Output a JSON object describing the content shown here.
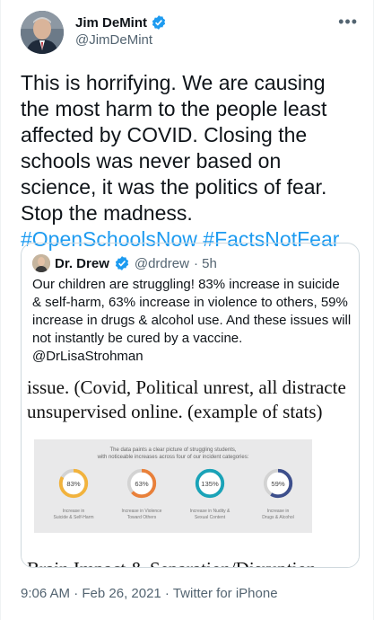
{
  "author": {
    "display_name": "Jim DeMint",
    "handle": "@JimDeMint",
    "avatar_icon": "avatar-photo",
    "verified_icon": "verified-badge-icon"
  },
  "tweet": {
    "text": "This is horrifying. We are causing the most harm to the people least affected by COVID. Closing the schools was never based on science, it was the politics of fear. Stop the madness.",
    "hashtags": "#OpenSchoolsNow #FactsNotFear"
  },
  "quote": {
    "display_name": "Dr. Drew",
    "handle": "@drdrew",
    "time": "· 5h",
    "text": "Our children are struggling! 83% increase in suicide & self-harm, 63% increase in violence to others, 59% increase in drugs & alcohol use. And these issues will not instantly be cured by a vaccine. @DrLisaStrohman",
    "image": {
      "line1": "issue. (Covid, Political unrest, all distracte",
      "line2": "unsupervised online. (example of stats)",
      "bottom_line": "Brain Impact & Separation/Disruption",
      "panel_title_1": "The data paints a clear picture of struggling students,",
      "panel_title_2": "with noticeable increases across four of our incident categories:",
      "stats": [
        {
          "value": "83%",
          "label_1": "Increase in",
          "label_2": "Suicide & Self-Harm",
          "color": "#f2b33d",
          "fraction": 0.83
        },
        {
          "value": "63%",
          "label_1": "Increase in Violence",
          "label_2": "Toward Others",
          "color": "#e9803a",
          "fraction": 0.63
        },
        {
          "value": "135%",
          "label_1": "Increase in Nudity &",
          "label_2": "Sexual Content",
          "color": "#1aa3b8",
          "fraction": 1.0
        },
        {
          "value": "59%",
          "label_1": "Increase in",
          "label_2": "Drugs & Alcohol",
          "color": "#3d4f8c",
          "fraction": 0.59
        }
      ]
    }
  },
  "footer": {
    "timestamp": "9:06 AM · Feb 26, 2021 · Twitter for iPhone"
  },
  "menu": {
    "more_icon": "more-icon"
  }
}
